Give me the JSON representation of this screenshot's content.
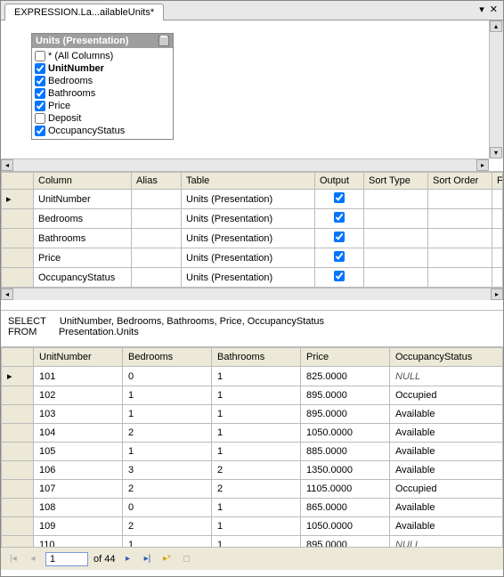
{
  "tab": {
    "title": "EXPRESSION.La...ailableUnits*"
  },
  "entity": {
    "title": "Units (Presentation)",
    "columns": [
      {
        "label": "* (All Columns)",
        "checked": false,
        "bold": false
      },
      {
        "label": "UnitNumber",
        "checked": true,
        "bold": true
      },
      {
        "label": "Bedrooms",
        "checked": true,
        "bold": false
      },
      {
        "label": "Bathrooms",
        "checked": true,
        "bold": false
      },
      {
        "label": "Price",
        "checked": true,
        "bold": false
      },
      {
        "label": "Deposit",
        "checked": false,
        "bold": false
      },
      {
        "label": "OccupancyStatus",
        "checked": true,
        "bold": false
      }
    ]
  },
  "criteria": {
    "headers": [
      "Column",
      "Alias",
      "Table",
      "Output",
      "Sort Type",
      "Sort Order",
      "Filt"
    ],
    "rows": [
      {
        "column": "UnitNumber",
        "alias": "",
        "table": "Units (Presentation)",
        "output": true,
        "sortType": "",
        "sortOrder": ""
      },
      {
        "column": "Bedrooms",
        "alias": "",
        "table": "Units (Presentation)",
        "output": true,
        "sortType": "",
        "sortOrder": ""
      },
      {
        "column": "Bathrooms",
        "alias": "",
        "table": "Units (Presentation)",
        "output": true,
        "sortType": "",
        "sortOrder": ""
      },
      {
        "column": "Price",
        "alias": "",
        "table": "Units (Presentation)",
        "output": true,
        "sortType": "",
        "sortOrder": ""
      },
      {
        "column": "OccupancyStatus",
        "alias": "",
        "table": "Units (Presentation)",
        "output": true,
        "sortType": "",
        "sortOrder": ""
      }
    ]
  },
  "sql": "SELECT     UnitNumber, Bedrooms, Bathrooms, Price, OccupancyStatus\nFROM        Presentation.Units",
  "results": {
    "headers": [
      "UnitNumber",
      "Bedrooms",
      "Bathrooms",
      "Price",
      "OccupancyStatus"
    ],
    "rows": [
      {
        "UnitNumber": "101",
        "Bedrooms": "0",
        "Bathrooms": "1",
        "Price": "825.0000",
        "OccupancyStatus": "NULL"
      },
      {
        "UnitNumber": "102",
        "Bedrooms": "1",
        "Bathrooms": "1",
        "Price": "895.0000",
        "OccupancyStatus": "Occupied"
      },
      {
        "UnitNumber": "103",
        "Bedrooms": "1",
        "Bathrooms": "1",
        "Price": "895.0000",
        "OccupancyStatus": "Available"
      },
      {
        "UnitNumber": "104",
        "Bedrooms": "2",
        "Bathrooms": "1",
        "Price": "1050.0000",
        "OccupancyStatus": "Available"
      },
      {
        "UnitNumber": "105",
        "Bedrooms": "1",
        "Bathrooms": "1",
        "Price": "885.0000",
        "OccupancyStatus": "Available"
      },
      {
        "UnitNumber": "106",
        "Bedrooms": "3",
        "Bathrooms": "2",
        "Price": "1350.0000",
        "OccupancyStatus": "Available"
      },
      {
        "UnitNumber": "107",
        "Bedrooms": "2",
        "Bathrooms": "2",
        "Price": "1105.0000",
        "OccupancyStatus": "Occupied"
      },
      {
        "UnitNumber": "108",
        "Bedrooms": "0",
        "Bathrooms": "1",
        "Price": "865.0000",
        "OccupancyStatus": "Available"
      },
      {
        "UnitNumber": "109",
        "Bedrooms": "2",
        "Bathrooms": "1",
        "Price": "1050.0000",
        "OccupancyStatus": "Available"
      },
      {
        "UnitNumber": "110",
        "Bedrooms": "1",
        "Bathrooms": "1",
        "Price": "895.0000",
        "OccupancyStatus": "NULL"
      }
    ]
  },
  "nav": {
    "current": "1",
    "of_label": "of 44"
  }
}
